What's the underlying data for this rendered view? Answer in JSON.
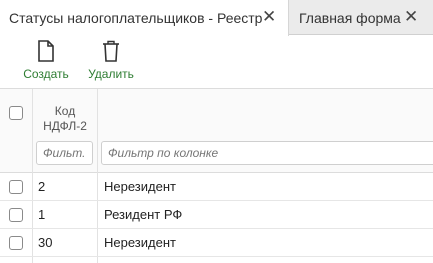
{
  "tabs": [
    {
      "label": "Статусы налогоплательщиков - Реестр",
      "close": "✕"
    },
    {
      "label": "Главная форма",
      "close": "✕"
    }
  ],
  "toolbar": {
    "create_label": "Создать",
    "delete_label": "Удалить",
    "accent": "#2e7d32"
  },
  "grid": {
    "column_header": "Код НДФЛ-2",
    "filter_code_placeholder": "Фильт...",
    "filter_name_placeholder": "Фильтр по колонке",
    "rows": [
      {
        "code": "2",
        "name": "Нерезидент"
      },
      {
        "code": "1",
        "name": "Резидент РФ"
      },
      {
        "code": "30",
        "name": "Нерезидент"
      }
    ]
  }
}
